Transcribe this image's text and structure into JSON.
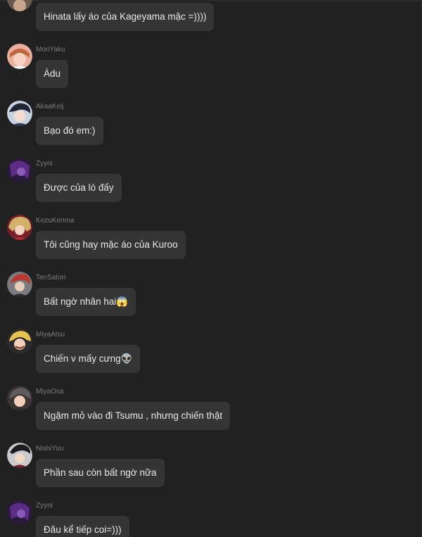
{
  "messages": [
    {
      "user": "",
      "text": "Hinata lấy áo của Kageyama mặc =))))",
      "avatar": "partial-avatar"
    },
    {
      "user": "MoriYaku",
      "text": "Ádu",
      "avatar": "moriyaku-avatar"
    },
    {
      "user": "AkaaKeij",
      "text": "Bạo đó em:)",
      "avatar": "akaakeij-avatar"
    },
    {
      "user": "Zyyni",
      "text": "Được của ló đấy",
      "avatar": "zyyni-avatar"
    },
    {
      "user": "KozuKenma",
      "text": "Tôi cũng hay mặc áo của Kuroo",
      "avatar": "kozukenma-avatar"
    },
    {
      "user": "TenSatori",
      "text": "Bất ngờ nhân hai😱",
      "avatar": "tensatori-avatar"
    },
    {
      "user": "MiyaAtsu",
      "text": "Chiến v mấy cưng👽",
      "avatar": "miyaatsu-avatar"
    },
    {
      "user": "MiyaOsa",
      "text": "Ngậm mỏ vào đi Tsumu , nhưng chiến thật",
      "avatar": "miyaosa-avatar"
    },
    {
      "user": "NishiYuu",
      "text": "Phần sau còn bất ngờ nữa",
      "avatar": "nishiyuu-avatar"
    },
    {
      "user": "Zyyni",
      "text": "Đâu kể tiếp coi=)))",
      "avatar": "zyyni-avatar"
    }
  ]
}
